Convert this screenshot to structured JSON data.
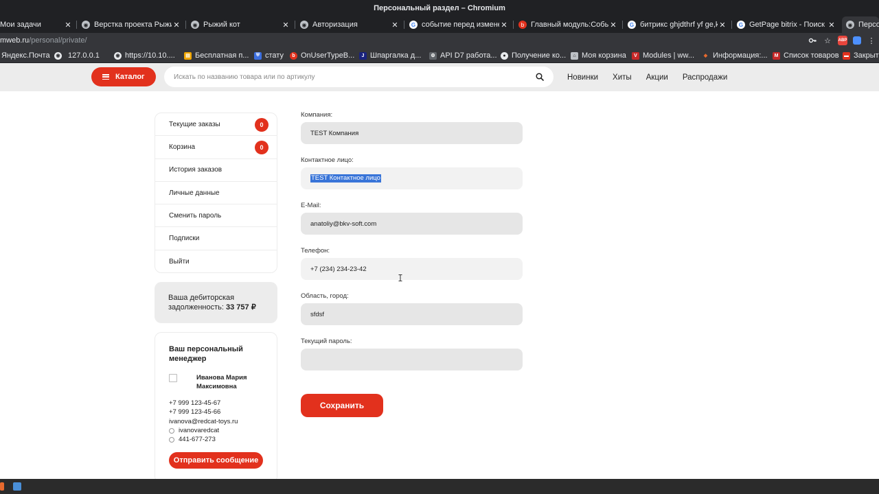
{
  "window": {
    "title": "Персональный раздел – Chromium"
  },
  "tabs": [
    {
      "title": "Мои задачи",
      "favicon": "tasks-icon",
      "active": false
    },
    {
      "title": "Верстка проекта Рыжий",
      "favicon": "globe-icon",
      "active": false
    },
    {
      "title": "Рыжий кот",
      "favicon": "globe-icon",
      "active": false
    },
    {
      "title": "Авторизация",
      "favicon": "globe-icon",
      "active": false
    },
    {
      "title": "событие перед изменен",
      "favicon": "google-icon",
      "active": false
    },
    {
      "title": "Главный модуль:Событ",
      "favicon": "bitrix-icon",
      "active": false
    },
    {
      "title": "битрикс ghjdthrf yf ge,kt",
      "favicon": "google-icon",
      "active": false
    },
    {
      "title": "GetPage bitrix - Поиск в",
      "favicon": "google-icon",
      "active": false
    },
    {
      "title": "Персо",
      "favicon": "globe-icon",
      "active": true
    }
  ],
  "address_bar": {
    "host": "mweb.ru",
    "path": "/personal/private/"
  },
  "bookmarks": [
    {
      "label": "Яндекс.Почта",
      "icon": "yandex-mail-icon"
    },
    {
      "label": "127.0.0.1",
      "icon": "globe-icon"
    },
    {
      "label": "https://10.10....",
      "icon": "globe-icon"
    },
    {
      "label": "Бесплатная п...",
      "icon": "stats-icon"
    },
    {
      "label": "стату",
      "icon": "shield-icon"
    },
    {
      "label": "OnUserTypeB...",
      "icon": "bitrix-icon"
    },
    {
      "label": "Шпаргалка д...",
      "icon": "j-icon"
    },
    {
      "label": "API D7 работа...",
      "icon": "robot-icon"
    },
    {
      "label": "Получение ко...",
      "icon": "github-icon"
    },
    {
      "label": "Моя корзина",
      "icon": "cart-icon"
    },
    {
      "label": "Modules | ww...",
      "icon": "v-icon"
    },
    {
      "label": "Информация:...",
      "icon": "diamond-icon"
    },
    {
      "label": "Список товаров",
      "icon": "m-icon"
    },
    {
      "label": "Закрыть",
      "icon": "folder-icon"
    }
  ],
  "header": {
    "catalog_label": "Каталог",
    "search_placeholder": "Искать по названию товара или по артикулу",
    "nav": [
      "Новинки",
      "Хиты",
      "Акции",
      "Распродажи"
    ]
  },
  "sidebar": {
    "menu": [
      {
        "label": "Текущие заказы",
        "badge": "0"
      },
      {
        "label": "Корзина",
        "badge": "0"
      },
      {
        "label": "История заказов"
      },
      {
        "label": "Личные данные"
      },
      {
        "label": "Сменить пароль"
      },
      {
        "label": "Подписки"
      },
      {
        "label": "Выйти"
      }
    ],
    "debt": {
      "label": "Ваша дебиторская задолженность:",
      "amount": "33 757 ₽"
    },
    "manager": {
      "title": "Ваш персональный менеджер",
      "name": "Иванова Мария Максимовна",
      "phone1": "+7 999 123-45-67",
      "phone2": "+7 999 123-45-66",
      "email": "ivanova@redcat-toys.ru",
      "skype": "ivanovaredcat",
      "icq": "441-677-273",
      "button": "Отправить сообщение"
    }
  },
  "form": {
    "fields": [
      {
        "label": "Компания:",
        "value": "TEST Компания",
        "placeholder": ""
      },
      {
        "label": "Контактное лицо:",
        "value": "TEST Контактное лицо",
        "placeholder": ""
      },
      {
        "label": "E-Mail:",
        "value": "anatoliy@bkv-soft.com",
        "placeholder": ""
      },
      {
        "label": "Телефон:",
        "value": "+7 (234) 234-23-42",
        "placeholder": ""
      },
      {
        "label": "Область, город:",
        "value": "sfdsf",
        "placeholder": ""
      },
      {
        "label": "Текущий пароль:",
        "value": "",
        "placeholder": ""
      }
    ],
    "save_label": "Сохранить"
  },
  "colors": {
    "accent": "#e2311d",
    "header_bg": "#ececec",
    "field_bg": "#e6e6e6",
    "chrome_dark": "#202124",
    "selection": "#3874d8"
  }
}
